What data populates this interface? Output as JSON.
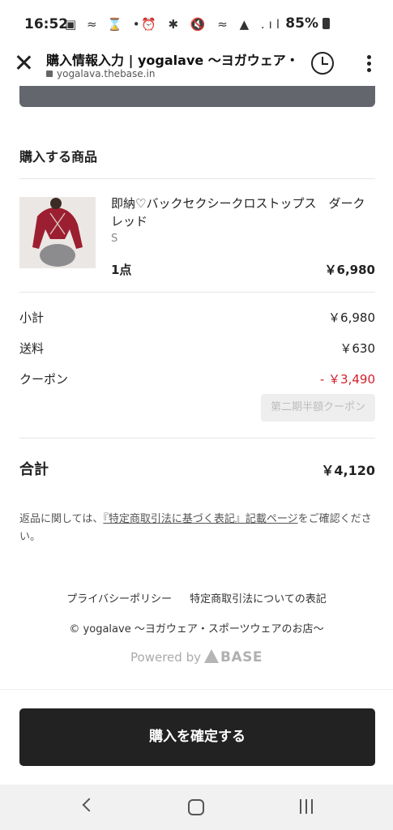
{
  "status_bar": {
    "time": "16:52",
    "left_icons": "▣ ≈ ⌛ •",
    "right_icons": "⏰ ✱ 🔇 ≈ ▲ .ıl",
    "battery": "85%"
  },
  "browser": {
    "title": "購入情報入力 | yogalave 〜ヨガウェア・",
    "url": "yogalava.thebase.in"
  },
  "order": {
    "section_title": "購入する商品",
    "product": {
      "name": "即納♡バックセクシークロストップス　ダークレッド",
      "variant": "S",
      "quantity": "1点",
      "price": "￥6,980"
    },
    "summary": [
      {
        "label": "小計",
        "value": "￥6,980"
      },
      {
        "label": "送料",
        "value": "￥630"
      },
      {
        "label": "クーポン",
        "value": "- ￥3,490"
      }
    ],
    "coupon_tag": "第二期半額クーポン",
    "total_label": "合計",
    "total_value": "￥4,120"
  },
  "notice": {
    "before": "返品に関しては、",
    "link": "『特定商取引法に基づく表記』記載ページ",
    "after": "をご確認ください。"
  },
  "footer": {
    "privacy": "プライバシーポリシー",
    "legal": "特定商取引法についての表記",
    "copyright": "© yogalave 〜ヨガウェア・スポーツウェアのお店〜",
    "powered_by": "Powered by",
    "base": "BASE"
  },
  "confirm_button": "購入を確定する",
  "colors": {
    "discount": "#d0202b",
    "button": "#222222"
  }
}
